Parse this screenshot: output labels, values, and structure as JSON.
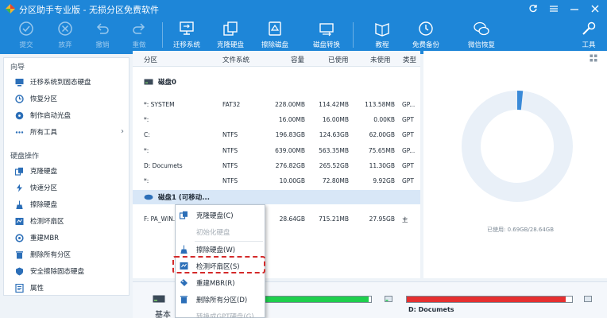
{
  "app": {
    "title": "分区助手专业版 - 无损分区免费软件"
  },
  "toolbar": {
    "buttons": [
      {
        "label": "提交",
        "icon": "submit-icon",
        "enabled": false
      },
      {
        "label": "放弃",
        "icon": "discard-icon",
        "enabled": false
      },
      {
        "label": "撤销",
        "icon": "undo-icon",
        "enabled": false
      },
      {
        "label": "重做",
        "icon": "redo-icon",
        "enabled": false
      },
      {
        "label": "迁移系统",
        "icon": "migrate-os-icon",
        "enabled": true
      },
      {
        "label": "克隆硬盘",
        "icon": "clone-disk-icon",
        "enabled": true
      },
      {
        "label": "擦除磁盘",
        "icon": "wipe-disk-icon",
        "enabled": true
      },
      {
        "label": "磁盘转换",
        "icon": "convert-disk-icon",
        "enabled": true
      },
      {
        "label": "教程",
        "icon": "tutorial-icon",
        "enabled": true
      },
      {
        "label": "免费备份",
        "icon": "backup-icon",
        "enabled": true
      },
      {
        "label": "微信恢复",
        "icon": "wechat-restore-icon",
        "enabled": true
      },
      {
        "label": "工具",
        "icon": "tools-icon",
        "enabled": true
      }
    ]
  },
  "sidebar": {
    "section1": "向导",
    "section2": "硬盘操作",
    "wizard_items": [
      {
        "label": "迁移系统到固态硬盘",
        "icon": "migrate-icon"
      },
      {
        "label": "恢复分区",
        "icon": "restore-partition-icon"
      },
      {
        "label": "制作启动光盘",
        "icon": "bootable-media-icon"
      },
      {
        "label": "所有工具",
        "icon": "more-icon"
      }
    ],
    "disk_items": [
      {
        "label": "克隆硬盘",
        "icon": "clone-icon"
      },
      {
        "label": "快速分区",
        "icon": "quick-partition-icon"
      },
      {
        "label": "擦除硬盘",
        "icon": "wipe-icon"
      },
      {
        "label": "检测坏扇区",
        "icon": "bad-sector-icon"
      },
      {
        "label": "重建MBR",
        "icon": "rebuild-mbr-icon"
      },
      {
        "label": "删除所有分区",
        "icon": "delete-all-icon"
      },
      {
        "label": "安全擦除固态硬盘",
        "icon": "secure-erase-icon"
      },
      {
        "label": "属性",
        "icon": "properties-icon"
      }
    ]
  },
  "table": {
    "headers": {
      "partition": "分区",
      "filesystem": "文件系统",
      "capacity": "容量",
      "used": "已使用",
      "unused": "未使用",
      "type": "类型"
    },
    "disk0": {
      "label": "磁盘0",
      "rows": [
        [
          "*: SYSTEM",
          "FAT32",
          "228.00MB",
          "114.42MB",
          "113.58MB",
          "GP..."
        ],
        [
          "*:",
          "",
          "16.00MB",
          "16.00MB",
          "0.00KB",
          "GPT"
        ],
        [
          "C:",
          "NTFS",
          "196.83GB",
          "124.63GB",
          "62.00GB",
          "GPT"
        ],
        [
          "*:",
          "NTFS",
          "639.00MB",
          "563.35MB",
          "75.65MB",
          "GP..."
        ],
        [
          "D: Documets",
          "NTFS",
          "276.82GB",
          "265.52GB",
          "11.30GB",
          "GPT"
        ],
        [
          "*:",
          "NTFS",
          "10.00GB",
          "72.80MB",
          "9.92GB",
          "GPT"
        ]
      ]
    },
    "disk1": {
      "label": "磁盘1 (可移动...",
      "rows": [
        [
          "F: PA_WIN...",
          "",
          "28.64GB",
          "715.21MB",
          "27.95GB",
          "主"
        ]
      ]
    }
  },
  "context_menu": {
    "items": [
      {
        "label": "克隆硬盘(C)",
        "icon": "clone-disk-icon",
        "enabled": true
      },
      {
        "label": "初始化硬盘",
        "icon": "init-disk-icon",
        "enabled": false
      },
      {
        "label": "擦除硬盘(W)",
        "icon": "wipe-disk-icon",
        "enabled": true
      },
      {
        "label": "检测坏扇区(S)",
        "icon": "check-bad-sector-icon",
        "enabled": true,
        "highlighted": true
      },
      {
        "label": "重建MBR(R)",
        "icon": "rebuild-mbr-icon",
        "enabled": true
      },
      {
        "label": "删除所有分区(D)",
        "icon": "delete-partitions-icon",
        "enabled": true
      },
      {
        "label": "转换成GPT硬盘(G)",
        "icon": "convert-gpt-icon",
        "enabled": false
      }
    ]
  },
  "right_panel": {
    "summary": "已使用: 0.69GB/28.64GB"
  },
  "bottom": {
    "disk_type": "基本",
    "partition_label": "D: Documets"
  },
  "colors": {
    "accent": "#1e86d8",
    "used_fill_green": "#1fcf4d",
    "used_fill_red": "#e53030",
    "highlight_box": "#d42a2a",
    "donut": "#e9f0f8"
  }
}
